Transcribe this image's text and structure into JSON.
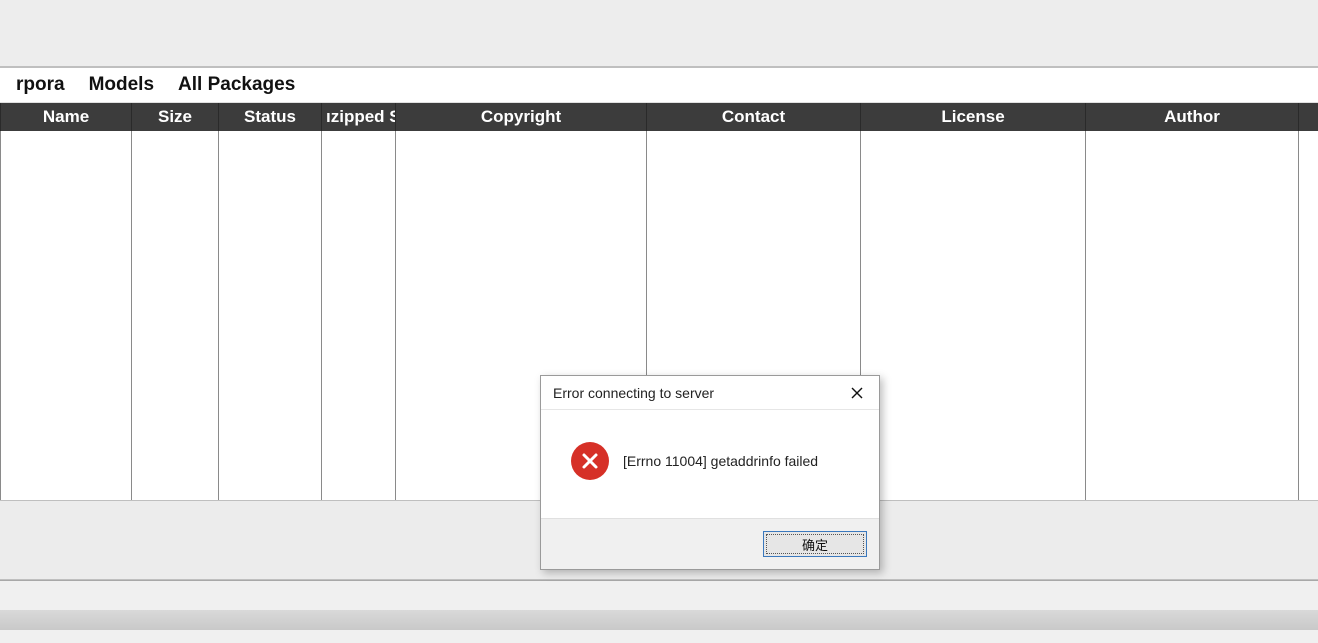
{
  "tabs": {
    "corpora": "rpora",
    "models": "Models",
    "all_packages": "All Packages"
  },
  "columns": {
    "name": "Name",
    "size": "Size",
    "status": "Status",
    "unzipped_size": "ızipped Si",
    "copyright": "Copyright",
    "contact": "Contact",
    "license": "License",
    "author": "Author"
  },
  "rows": [],
  "dialog": {
    "title": "Error connecting to server",
    "message": "[Errno 11004] getaddrinfo failed",
    "ok_label": "确定",
    "icon": "error"
  }
}
